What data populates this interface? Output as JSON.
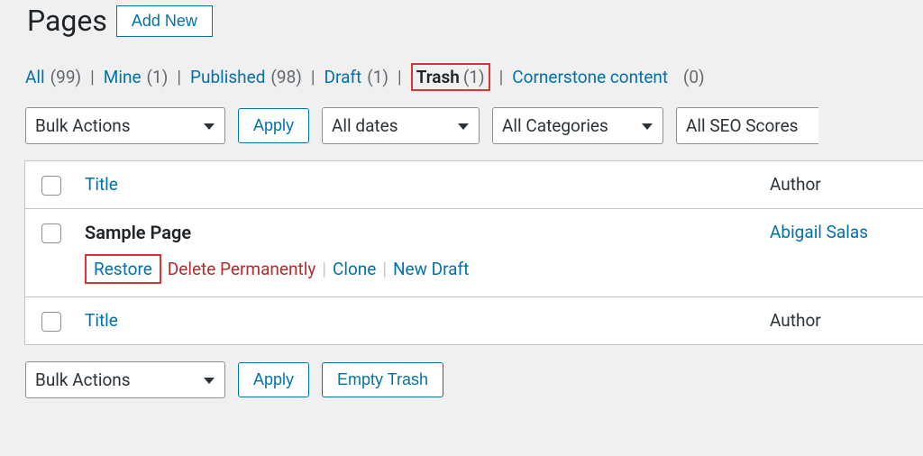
{
  "header": {
    "title": "Pages",
    "add_new_label": "Add New"
  },
  "filters": {
    "all": {
      "label": "All",
      "count": "(99)"
    },
    "mine": {
      "label": "Mine",
      "count": "(1)"
    },
    "published": {
      "label": "Published",
      "count": "(98)"
    },
    "draft": {
      "label": "Draft",
      "count": "(1)"
    },
    "trash": {
      "label": "Trash",
      "count": "(1)"
    },
    "cornerstone": {
      "label": "Cornerstone content",
      "count": "(0)"
    }
  },
  "toolbar_top": {
    "bulk_actions": "Bulk Actions",
    "apply": "Apply",
    "all_dates": "All dates",
    "all_categories": "All Categories",
    "all_seo": "All SEO Scores"
  },
  "table": {
    "columns": {
      "title": "Title",
      "author": "Author"
    },
    "rows": [
      {
        "title": "Sample Page",
        "author": "Abigail Salas",
        "actions": {
          "restore": "Restore",
          "delete_permanently": "Delete Permanently",
          "clone": "Clone",
          "new_draft": "New Draft"
        }
      }
    ]
  },
  "toolbar_bottom": {
    "bulk_actions": "Bulk Actions",
    "apply": "Apply",
    "empty_trash": "Empty Trash"
  }
}
